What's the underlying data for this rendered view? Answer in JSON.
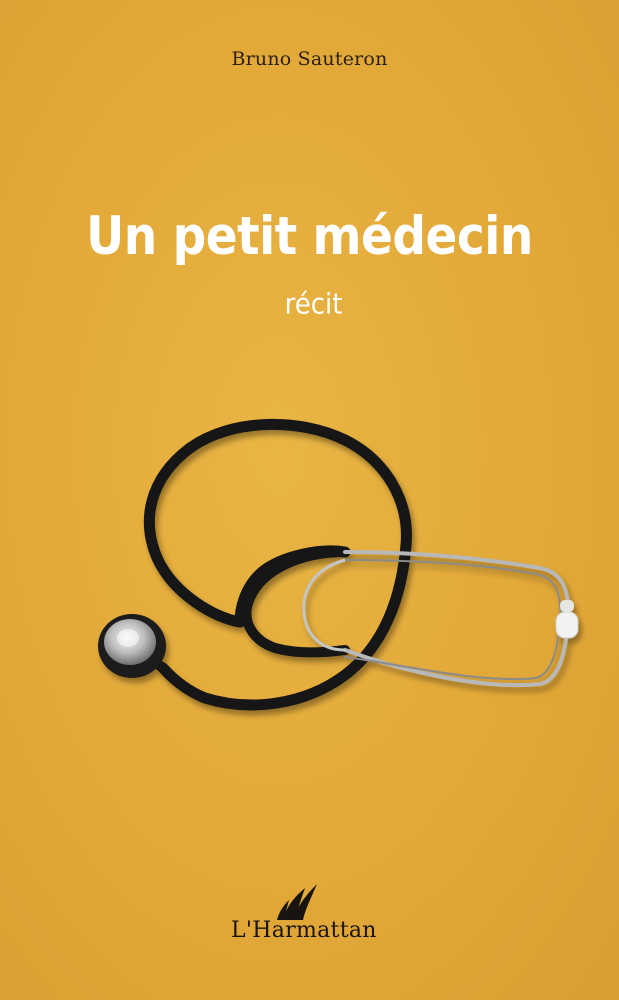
{
  "cover": {
    "author": "Bruno Sauteron",
    "title": "Un petit médecin",
    "subtitle": "récit",
    "publisher": "L'Harmattan",
    "background_color": "#e2a838",
    "text_color": "#ffffff"
  },
  "illustration": {
    "icon": "stethoscope-icon"
  }
}
